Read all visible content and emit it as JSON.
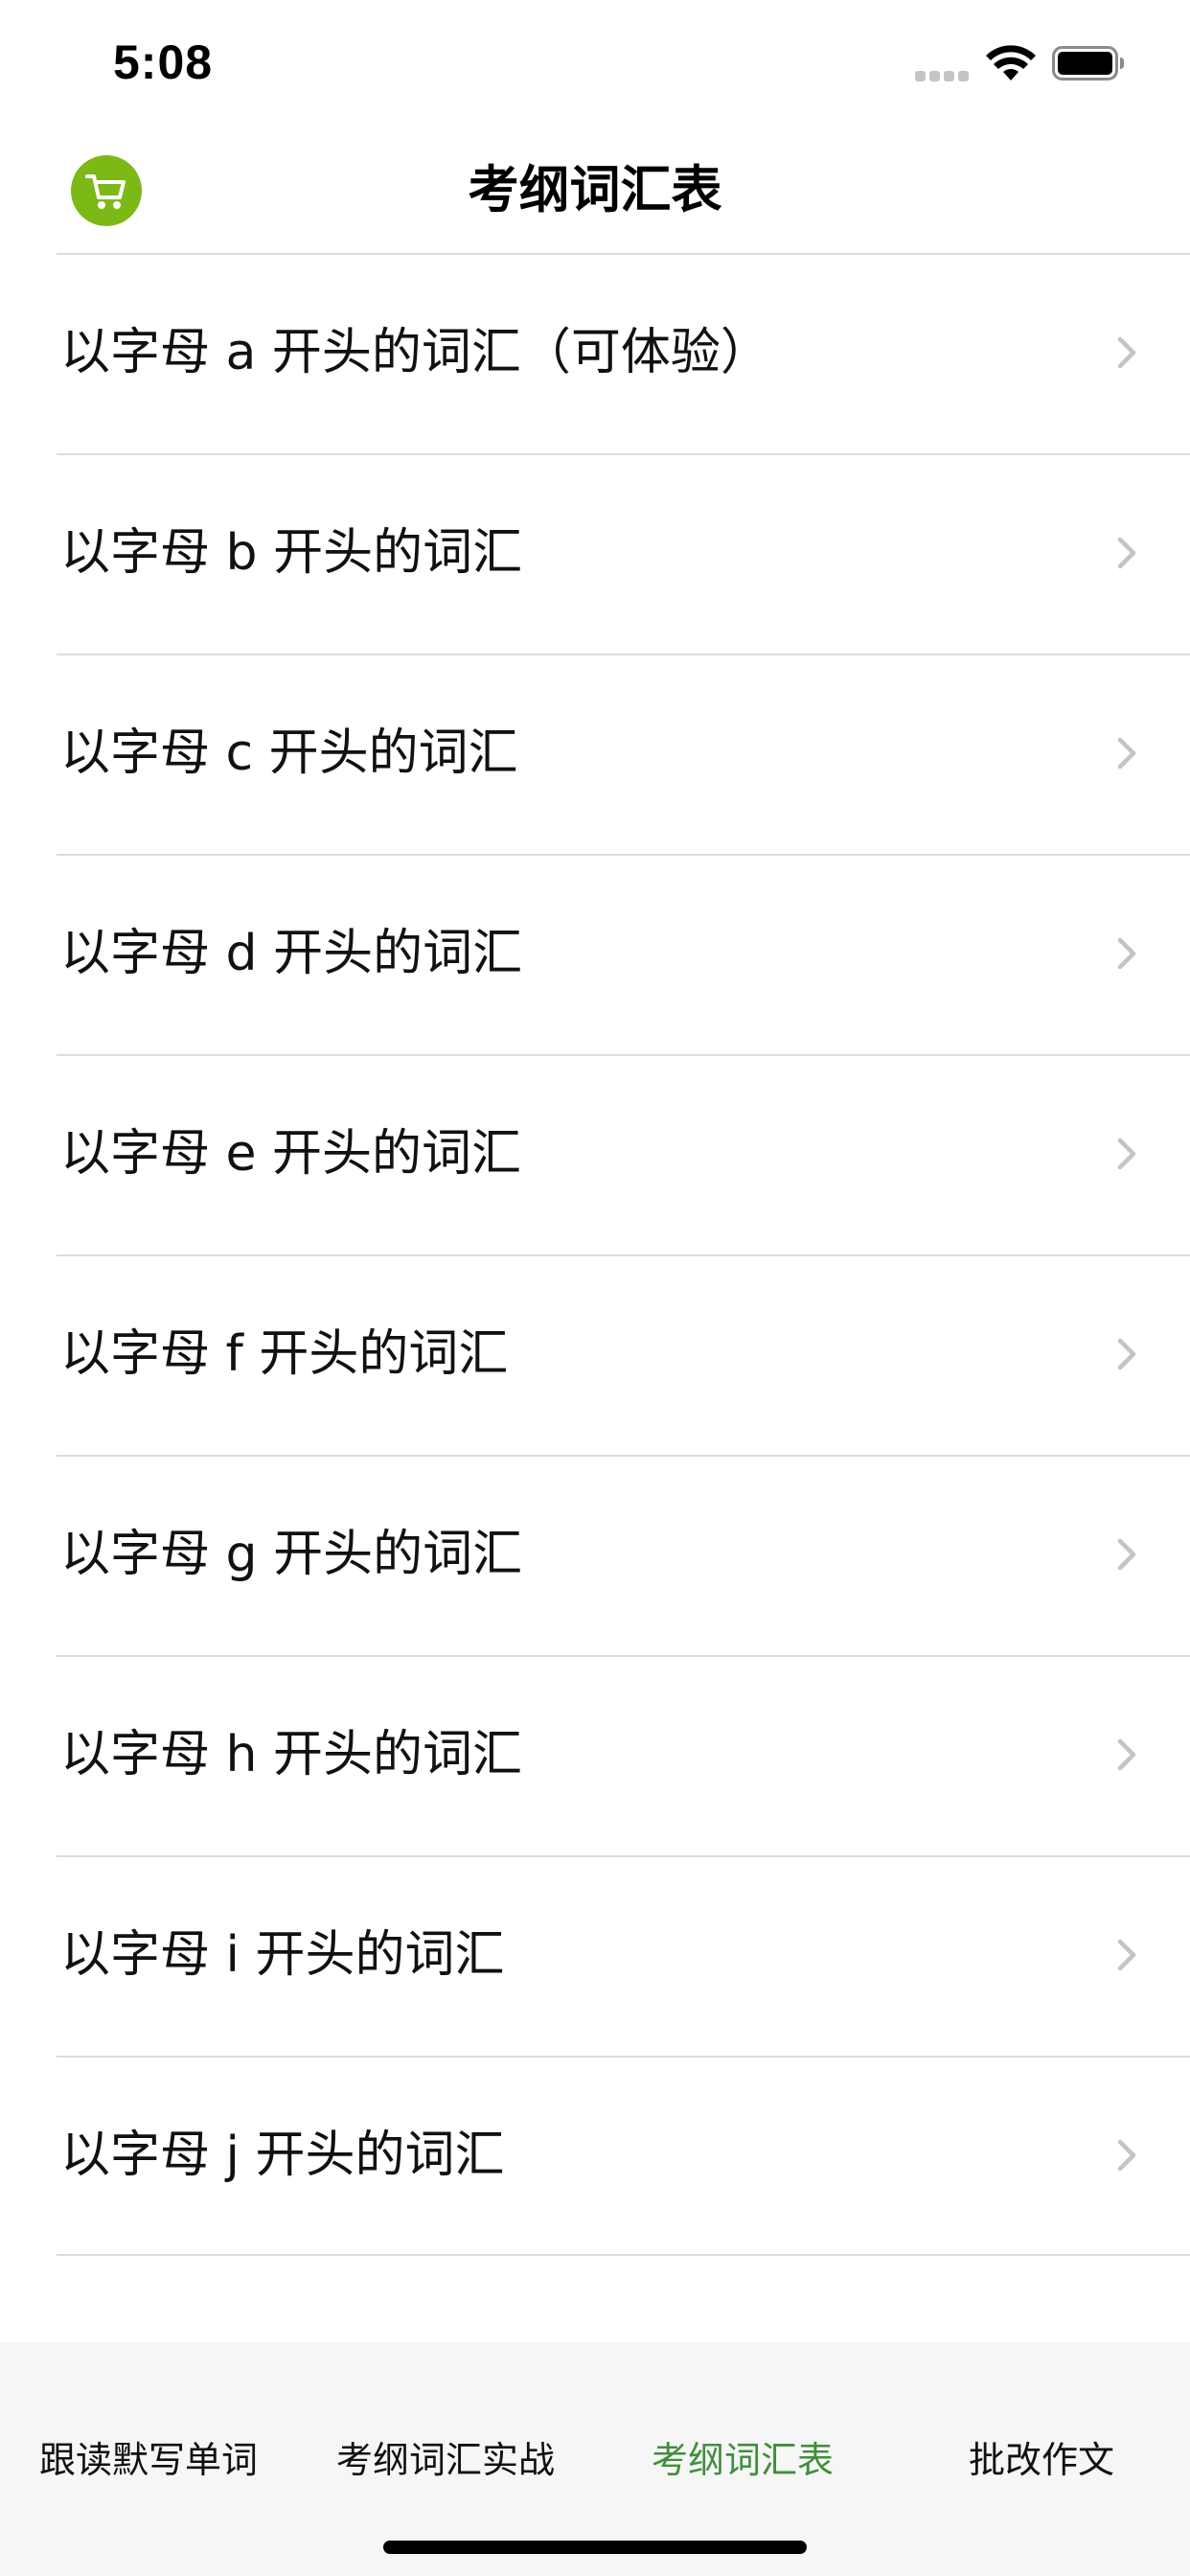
{
  "status_bar": {
    "time": "5:08",
    "icons": [
      "cellular-signal-icon",
      "wifi-icon",
      "battery-icon"
    ]
  },
  "nav": {
    "title": "考纲词汇表",
    "cart_icon": "shopping-cart-icon",
    "cart_color": "#7cb917"
  },
  "list": {
    "items": [
      {
        "label": "以字母 a 开头的词汇（可体验）"
      },
      {
        "label": "以字母 b 开头的词汇"
      },
      {
        "label": "以字母 c 开头的词汇"
      },
      {
        "label": "以字母 d 开头的词汇"
      },
      {
        "label": "以字母 e 开头的词汇"
      },
      {
        "label": "以字母 f 开头的词汇"
      },
      {
        "label": "以字母 g 开头的词汇"
      },
      {
        "label": "以字母 h 开头的词汇"
      },
      {
        "label": "以字母 i 开头的词汇"
      },
      {
        "label": "以字母 j 开头的词汇"
      }
    ],
    "chevron_icon": "chevron-right-icon"
  },
  "tab_bar": {
    "tabs": [
      {
        "label": "跟读默写单词",
        "active": false
      },
      {
        "label": "考纲词汇实战",
        "active": false
      },
      {
        "label": "考纲词汇表",
        "active": true
      },
      {
        "label": "批改作文",
        "active": false
      }
    ],
    "active_color": "#3f8f3a"
  }
}
